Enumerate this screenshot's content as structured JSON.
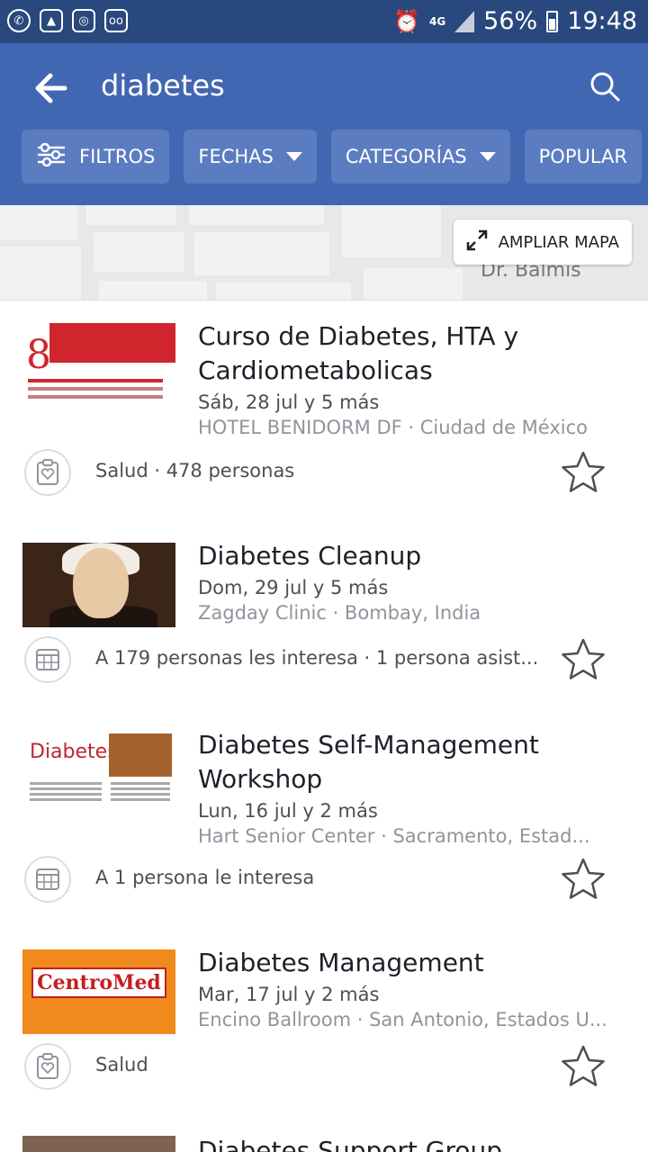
{
  "status_bar": {
    "icons": [
      "whatsapp-icon",
      "gallery-icon",
      "instagram-icon",
      "voicemail-icon",
      "alarm-icon"
    ],
    "network": "4G",
    "battery": "56%",
    "time": "19:48"
  },
  "app_bar": {
    "query": "diabetes",
    "filters": [
      {
        "label": "FILTROS",
        "icon": "sliders-icon"
      },
      {
        "label": "FECHAS",
        "icon": "caret-down-icon"
      },
      {
        "label": "CATEGORÍAS",
        "icon": "caret-down-icon"
      },
      {
        "label": "POPULAR",
        "icon": ""
      }
    ]
  },
  "map": {
    "street_label": "Dr. Balmis",
    "expand_label": "AMPLIAR MAPA"
  },
  "events": [
    {
      "title": "Curso de Diabetes, HTA y Cardiometabolicas",
      "date": "Sáb, 28 jul y 5 más",
      "place": "HOTEL BENIDORM DF · Ciudad de México",
      "meta": "Salud · 478 personas",
      "meta_icon": "clipboard-heart-icon",
      "thumb_text": {
        "num": "8º"
      }
    },
    {
      "title": "Diabetes Cleanup",
      "date": "Dom, 29 jul y 5 más",
      "place": "Zagday Clinic · Bombay, India",
      "meta": "A 179 personas les interesa · 1 persona asist...",
      "meta_icon": "calendar-icon"
    },
    {
      "title": "Diabetes Self-Management Workshop",
      "date": "Lun, 16 jul y 2 más",
      "place": "Hart Senior Center · Sacramento, Estad...",
      "meta": "A 1 persona le interesa",
      "meta_icon": "calendar-icon",
      "thumb_text": {
        "word": "Diabetes"
      }
    },
    {
      "title": "Diabetes Management",
      "date": "Mar, 17 jul y 2 más",
      "place": "Encino Ballroom · San Antonio, Estados U...",
      "meta": "Salud",
      "meta_icon": "clipboard-heart-icon",
      "thumb_text": {
        "logo": "CentroMed"
      }
    }
  ],
  "partial_event": {
    "title": "Diabetes Support Group"
  }
}
